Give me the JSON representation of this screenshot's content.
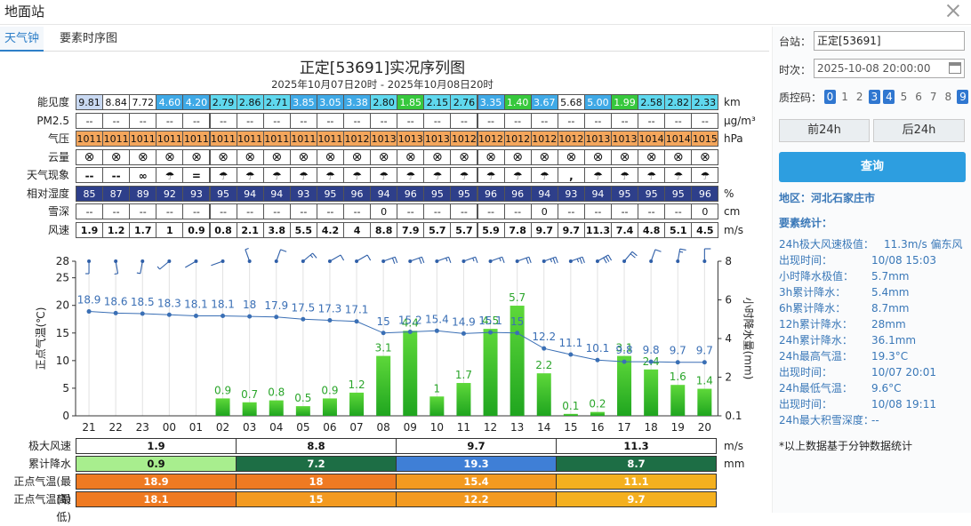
{
  "window": {
    "title": "地面站"
  },
  "tabs": [
    {
      "label": "天气钟"
    },
    {
      "label": "要素时序图"
    }
  ],
  "chart": {
    "title": "正定[53691]实况序列图",
    "subtitle": "2025年10月07日20时 - 2025年10月08日20时"
  },
  "table": {
    "rows": [
      {
        "label": "能见度",
        "unit": "km",
        "values": [
          "9.81",
          "8.84",
          "7.72",
          "4.60",
          "4.20",
          "2.79",
          "2.86",
          "2.71",
          "3.85",
          "3.05",
          "3.38",
          "2.80",
          "1.85",
          "2.15",
          "2.76",
          "3.35",
          "1.40",
          "3.67",
          "5.68",
          "5.00",
          "1.99",
          "2.58",
          "2.82",
          "2.33"
        ],
        "colors": [
          "#c9d9f2",
          "#ffffff",
          "#ffffff",
          "#3fa9e6",
          "#3fa9e6",
          "#5fd8ee",
          "#5fd8ee",
          "#5fd8ee",
          "#3fa9e6",
          "#3fa9e6",
          "#3fa9e6",
          "#5fd8ee",
          "#37c83d",
          "#5fd8ee",
          "#5fd8ee",
          "#3fa9e6",
          "#37c83d",
          "#3fa9e6",
          "#ffffff",
          "#3fa9e6",
          "#37c83d",
          "#5fd8ee",
          "#5fd8ee",
          "#5fd8ee"
        ]
      },
      {
        "label": "PM2.5",
        "unit": "μg/m³",
        "values": [
          "--",
          "--",
          "--",
          "--",
          "--",
          "--",
          "--",
          "--",
          "--",
          "--",
          "--",
          "--",
          "--",
          "--",
          "--",
          "--",
          "--",
          "--",
          "--",
          "--",
          "--",
          "--",
          "--",
          "--"
        ]
      },
      {
        "label": "气压",
        "unit": "hPa",
        "values": [
          "1011",
          "1011",
          "1011",
          "1011",
          "1011",
          "1011",
          "1011",
          "1011",
          "1011",
          "1011",
          "1012",
          "1013",
          "1013",
          "1013",
          "1012",
          "1012",
          "1012",
          "1012",
          "1012",
          "1013",
          "1013",
          "1014",
          "1014",
          "1015"
        ],
        "color": "#f4a65c"
      },
      {
        "label": "云量",
        "unit": "",
        "values": [
          "⊗",
          "⊗",
          "⊗",
          "⊗",
          "⊗",
          "⊗",
          "⊗",
          "⊗",
          "⊗",
          "⊗",
          "⊗",
          "⊗",
          "⊗",
          "⊗",
          "⊗",
          "⊗",
          "⊗",
          "⊗",
          "⊗",
          "⊗",
          "⊗",
          "⊗",
          "⊗",
          "⊗"
        ]
      },
      {
        "label": "天气现象",
        "unit": "",
        "values": [
          "--",
          "--",
          "∞",
          "☂",
          "=",
          "☂",
          "☂",
          "☂",
          "☂",
          "☂",
          "☂",
          "☂",
          "☂",
          "☂",
          "☂",
          "☂",
          "☂",
          "☂",
          ",",
          "☂",
          "☂",
          "☂",
          "☂",
          "☂"
        ]
      },
      {
        "label": "相对湿度",
        "unit": "%",
        "values": [
          "85",
          "87",
          "89",
          "92",
          "93",
          "95",
          "94",
          "94",
          "93",
          "95",
          "96",
          "94",
          "96",
          "95",
          "95",
          "96",
          "96",
          "94",
          "93",
          "94",
          "95",
          "95",
          "95",
          "96"
        ],
        "color": "#2e3f8a"
      },
      {
        "label": "雪深",
        "unit": "cm",
        "values": [
          "--",
          "--",
          "--",
          "--",
          "--",
          "--",
          "--",
          "--",
          "--",
          "--",
          "--",
          "0",
          "--",
          "--",
          "--",
          "--",
          "--",
          "0",
          "--",
          "--",
          "--",
          "--",
          "--",
          "0"
        ]
      },
      {
        "label": "风速",
        "unit": "m/s",
        "values": [
          "1.9",
          "1.2",
          "1.7",
          "1",
          "0.9",
          "0.8",
          "2.1",
          "3.8",
          "5.5",
          "4.2",
          "4",
          "8.8",
          "7.9",
          "5.7",
          "5.7",
          "5.9",
          "7.8",
          "9.7",
          "9.7",
          "11.3",
          "7.4",
          "4.8",
          "5.1",
          "4.5"
        ]
      }
    ]
  },
  "chart_data": {
    "type": "bar+line",
    "title": "正定[53691]实况序列图",
    "subtitle": "2025年10月07日20时 - 2025年10月08日20时",
    "categories": [
      "21",
      "22",
      "23",
      "00",
      "01",
      "02",
      "03",
      "04",
      "05",
      "06",
      "07",
      "08",
      "09",
      "10",
      "11",
      "12",
      "13",
      "14",
      "15",
      "16",
      "17",
      "18",
      "19",
      "20"
    ],
    "ylabel": "正点气温(℃)",
    "y2label": "小时降水量(mm)",
    "ylim": [
      0,
      28
    ],
    "yticks": [
      0,
      5,
      10,
      15,
      20,
      25,
      28
    ],
    "y2ticks": [
      "0.1",
      "2",
      "4",
      "6",
      "8"
    ],
    "y2lim": [
      0,
      8
    ],
    "series": [
      {
        "type": "line",
        "values": [
          18.9,
          18.6,
          18.5,
          18.3,
          18.1,
          18.1,
          18,
          17.9,
          17.5,
          17.3,
          17.1,
          15,
          15.2,
          15.4,
          14.9,
          15.1,
          15,
          12.2,
          11.1,
          10.1,
          9.8,
          9.8,
          9.7,
          9.7
        ],
        "labels": [
          "18.9",
          "18.6",
          "18.5",
          "18.3",
          "18.1",
          "18.1",
          "18",
          "17.9",
          "17.5",
          "17.3",
          "17.1",
          "15",
          "15.2",
          "15.4",
          "14.9",
          "15.1",
          "15",
          "12.2",
          "11.1",
          "10.1",
          "9.8",
          "9.8",
          "9.7",
          "9.7"
        ],
        "color": "#3a6fb5"
      },
      {
        "type": "bar",
        "values": [
          0,
          0,
          0,
          0,
          0,
          0.9,
          0.7,
          0.8,
          0.5,
          0.9,
          1.2,
          3.1,
          4.4,
          1,
          1.7,
          4.5,
          5.7,
          2.2,
          0.1,
          0.2,
          3.1,
          2.4,
          1.6,
          1.4
        ],
        "labels": [
          "",
          "",
          "",
          "",
          "",
          "0.9",
          "0.7",
          "0.8",
          "0.5",
          "0.9",
          "1.2",
          "3.1",
          "4.4",
          "1",
          "1.7",
          "4.5",
          "5.7",
          "2.2",
          "0.1",
          "0.2",
          "3.1",
          "2.4",
          "1.6",
          "1.4"
        ],
        "color": "#2fbf2f"
      }
    ],
    "wind_barbs": {
      "speed_ms": [
        1.9,
        1.2,
        1.7,
        1,
        0.9,
        0.8,
        2.1,
        3.8,
        5.5,
        4.2,
        4,
        8.8,
        7.9,
        5.7,
        5.7,
        5.9,
        7.8,
        9.7,
        9.7,
        11.3,
        7.4,
        4.8,
        5.1,
        4.5
      ],
      "direction_deg": [
        0,
        350,
        10,
        50,
        60,
        70,
        160,
        200,
        230,
        240,
        240,
        250,
        250,
        250,
        250,
        250,
        250,
        250,
        250,
        240,
        220,
        200,
        190,
        180
      ]
    }
  },
  "summary": {
    "rows": [
      {
        "label": "极大风速",
        "unit": "m/s",
        "cells": [
          {
            "text": "1.9",
            "color": "#ffffff"
          },
          {
            "text": "8.8",
            "color": "#ffffff"
          },
          {
            "text": "9.7",
            "color": "#ffffff"
          },
          {
            "text": "11.3",
            "color": "#ffffff"
          }
        ]
      },
      {
        "label": "累计降水",
        "unit": "mm",
        "cells": [
          {
            "text": "0.9",
            "color": "#a8ee8e"
          },
          {
            "text": "7.2",
            "color": "#1d6e45"
          },
          {
            "text": "19.3",
            "color": "#3f7fd6"
          },
          {
            "text": "8.7",
            "color": "#1d6e45"
          }
        ]
      },
      {
        "label": "正点气温(最高)",
        "unit": "",
        "cells": [
          {
            "text": "18.9",
            "color": "#ef7a22"
          },
          {
            "text": "18",
            "color": "#ef7a22"
          },
          {
            "text": "15.4",
            "color": "#f39a20"
          },
          {
            "text": "11.1",
            "color": "#f4b01f"
          }
        ]
      },
      {
        "label": "正点气温(最低)",
        "unit": "",
        "cells": [
          {
            "text": "18.1",
            "color": "#ef7a22"
          },
          {
            "text": "15",
            "color": "#f39a20"
          },
          {
            "text": "12.2",
            "color": "#f39a20"
          },
          {
            "text": "9.7",
            "color": "#f4b01f"
          }
        ]
      }
    ]
  },
  "sidebar": {
    "station_label": "台站：",
    "station_value": "正定[53691]",
    "time_label": "时次：",
    "time_value": "2025-10-08 20:00:00",
    "qc_label": "质控码：",
    "qc_codes": [
      {
        "text": "0",
        "on": true
      },
      {
        "text": "1",
        "on": false
      },
      {
        "text": "2",
        "on": false
      },
      {
        "text": "3",
        "on": true
      },
      {
        "text": "4",
        "on": true
      },
      {
        "text": "5",
        "on": false
      },
      {
        "text": "6",
        "on": false
      },
      {
        "text": "7",
        "on": false
      },
      {
        "text": "8",
        "on": false
      },
      {
        "text": "9",
        "on": true
      }
    ],
    "prev_button": "前24h",
    "next_button": "后24h",
    "query_button": "查询",
    "region": "地区：河北石家庄市",
    "stats_title": "要素统计：",
    "stats": [
      {
        "label": "24h极大风速极值：",
        "value": "11.3m/s 偏东风"
      },
      {
        "label": "出现时间：",
        "value": "10/08 15:03"
      },
      {
        "label": "小时降水极值：",
        "value": "5.7mm"
      },
      {
        "label": "3h累计降水：",
        "value": "5.4mm"
      },
      {
        "label": "6h累计降水：",
        "value": "8.7mm"
      },
      {
        "label": "12h累计降水：",
        "value": "28mm"
      },
      {
        "label": "24h累计降水：",
        "value": "36.1mm"
      },
      {
        "label": "24h最高气温：",
        "value": "19.3°C"
      },
      {
        "label": "出现时间：",
        "value": "10/07 20:01"
      },
      {
        "label": "24h最低气温：",
        "value": "9.6°C"
      },
      {
        "label": "出现时间：",
        "value": "10/08 19:11"
      },
      {
        "label": "24h最大积雪深度：",
        "value": "--"
      }
    ],
    "footnote": "*以上数据基于分钟数据统计"
  }
}
